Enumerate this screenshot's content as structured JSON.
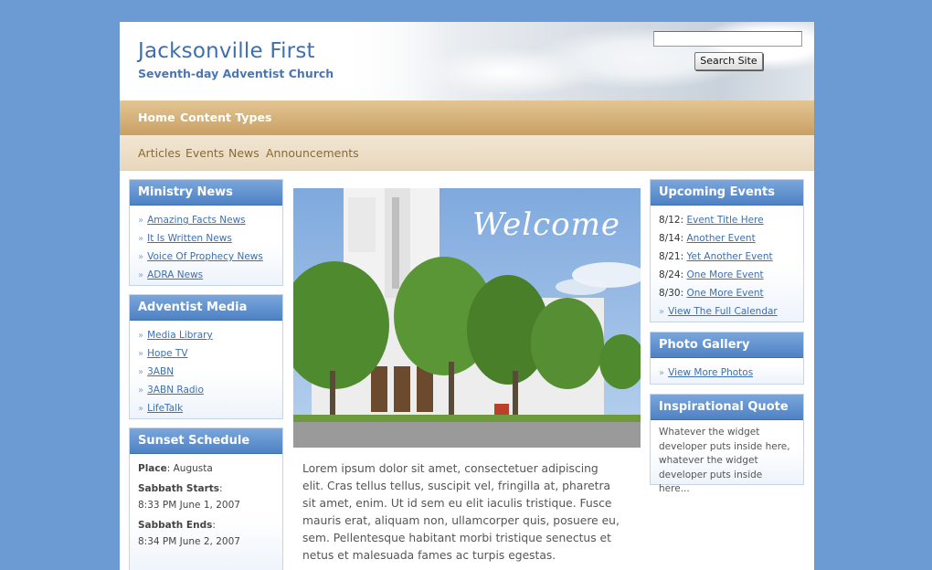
{
  "header": {
    "title": "Jacksonville First",
    "subtitle": "Seventh-day Adventist Church",
    "search": {
      "value": "",
      "button": "Search Site"
    }
  },
  "nav": {
    "items": [
      "Home",
      "Content Types"
    ]
  },
  "subnav": {
    "items": [
      "Articles",
      "Events",
      "News",
      "Announcements"
    ]
  },
  "ministry_news": {
    "title": "Ministry News",
    "links": [
      "Amazing Facts News",
      "It Is Written News",
      "Voice Of Prophecy News",
      "ADRA News"
    ]
  },
  "adventist_media": {
    "title": "Adventist Media",
    "links": [
      "Media Library",
      "Hope TV",
      "3ABN",
      "3ABN Radio",
      "LifeTalk"
    ]
  },
  "sunset": {
    "title": "Sunset Schedule",
    "place_label": "Place",
    "place": "Augusta",
    "starts_label": "Sabbath Starts",
    "starts": "8:33 PM June 1, 2007",
    "ends_label": "Sabbath Ends",
    "ends": "8:34 PM June 2, 2007"
  },
  "welcome": {
    "text": "Welcome"
  },
  "body_text": "Lorem ipsum dolor sit amet, consectetuer adipiscing elit. Cras tellus tellus, suscipit vel, fringilla at, pharetra sit amet, enim. Ut id sem eu elit iaculis tristique. Fusce mauris erat, aliquam non, ullamcorper quis, posuere eu, sem. Pellentesque habitant morbi tristique senectus et netus et malesuada fames ac turpis egestas.",
  "events": {
    "title": "Upcoming Events",
    "items": [
      {
        "date": "8/12:",
        "title": "Event Title Here"
      },
      {
        "date": "8/14:",
        "title": "Another Event"
      },
      {
        "date": "8/21:",
        "title": "Yet Another Event"
      },
      {
        "date": "8/24:",
        "title": "One More Event"
      },
      {
        "date": "8/30:",
        "title": "One More Event"
      }
    ],
    "full_calendar": "View The Full Calendar"
  },
  "gallery": {
    "title": "Photo Gallery",
    "link": "View More Photos"
  },
  "quote": {
    "title": "Inspirational Quote",
    "text": "Whatever the widget developer puts inside here, whatever the widget developer puts inside here..."
  },
  "colors": {
    "background": "#6b9bd2",
    "accent": "#4f82c4",
    "nav": "#c9a064",
    "link": "#3e6fae"
  }
}
